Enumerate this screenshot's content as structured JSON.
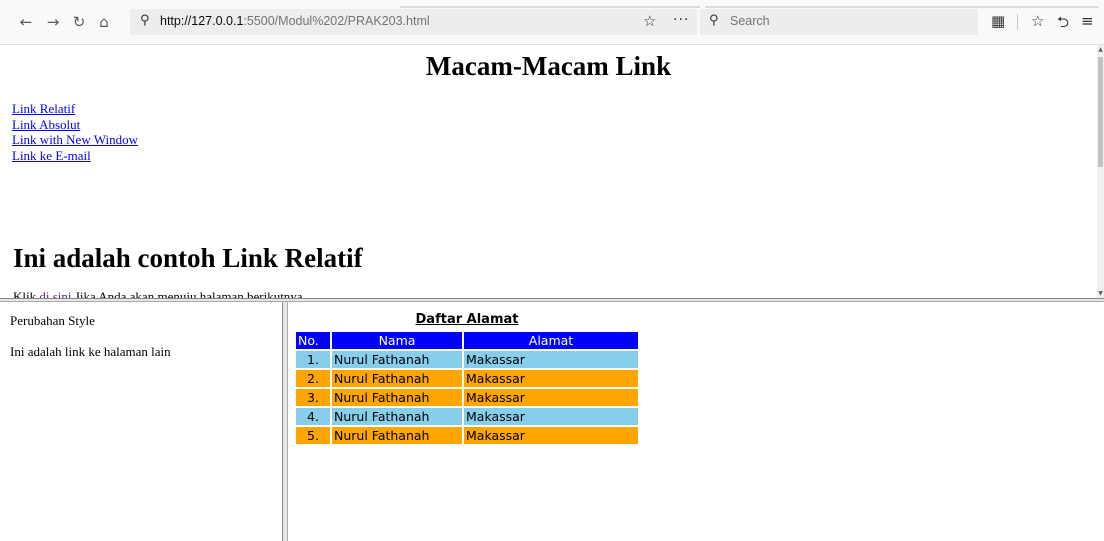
{
  "browser": {
    "url_host": "http://127.0.0.1",
    "url_path": ":5500/Modul%202/PRAK203.html",
    "search_placeholder": "Search",
    "icons": [
      "back-icon",
      "forward-icon",
      "reload-icon",
      "home-icon",
      "search-icon",
      "star-icon",
      "more-icon",
      "library-icon",
      "reader-icon",
      "sync-icon",
      "menu-icon"
    ]
  },
  "top_frame": {
    "title": "Macam-Macam Link",
    "links": [
      "Link Relatif",
      "Link Absolut",
      "Link with New Window",
      "Link ke E-mail"
    ],
    "section_heading": "Ini adalah contoh Link Relatif",
    "cut_text_prefix": "Klik ",
    "cut_text_link": "di sini",
    "cut_text_suffix": " Jika Anda akan menuju halaman berikutnya"
  },
  "left_frame": {
    "text1": "Perubahan Style",
    "text2": "Ini adalah link ke halaman lain"
  },
  "right_frame": {
    "caption": "Daftar Alamat",
    "headers": [
      "No.",
      "Nama",
      "Alamat"
    ],
    "rows": [
      {
        "no": "1.",
        "nama": "Nurul Fathanah",
        "alamat": "Makassar",
        "color": "#87ceeb"
      },
      {
        "no": "2.",
        "nama": "Nurul Fathanah",
        "alamat": "Makassar",
        "color": "#ffa500"
      },
      {
        "no": "3.",
        "nama": "Nurul Fathanah",
        "alamat": "Makassar",
        "color": "#ffa500"
      },
      {
        "no": "4.",
        "nama": "Nurul Fathanah",
        "alamat": "Makassar",
        "color": "#87ceeb"
      },
      {
        "no": "5.",
        "nama": "Nurul Fathanah",
        "alamat": "Makassar",
        "color": "#ffa500"
      }
    ],
    "header_color": "#0000ff"
  }
}
